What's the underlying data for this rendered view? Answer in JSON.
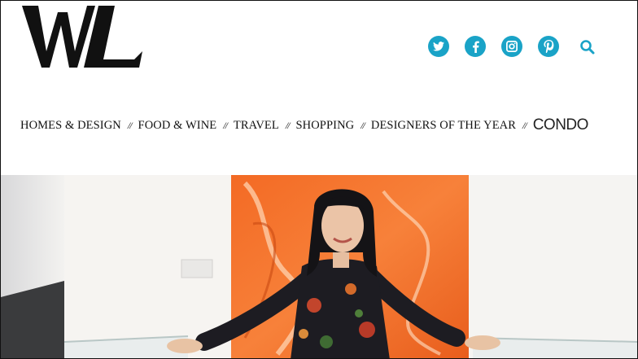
{
  "logo": {
    "text": "WL"
  },
  "social": [
    {
      "name": "twitter",
      "icon": "twitter-icon"
    },
    {
      "name": "facebook",
      "icon": "facebook-icon"
    },
    {
      "name": "instagram",
      "icon": "instagram-icon"
    },
    {
      "name": "pinterest",
      "icon": "pinterest-icon"
    }
  ],
  "search": {
    "icon": "search-icon"
  },
  "nav": {
    "separator": "//",
    "items": [
      {
        "label": "HOMES & DESIGN"
      },
      {
        "label": "FOOD & WINE"
      },
      {
        "label": "TRAVEL"
      },
      {
        "label": "SHOPPING"
      },
      {
        "label": "DESIGNERS OF THE YEAR"
      },
      {
        "label": "CONDO"
      }
    ]
  },
  "colors": {
    "accent": "#1aa3c7",
    "text": "#111111",
    "painting": "#f0692a",
    "background": "#ffffff"
  }
}
